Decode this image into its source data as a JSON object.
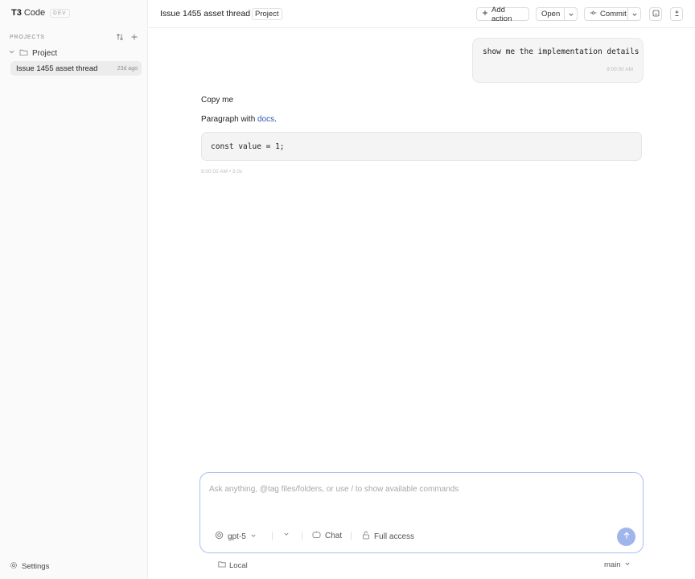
{
  "sidebar": {
    "brand_name": "T3",
    "brand_suffix": "Code",
    "env_badge": "DEV",
    "projects_label": "PROJECTS",
    "project": {
      "name": "Project",
      "expanded": true
    },
    "threads": [
      {
        "title": "Issue 1455 asset thread",
        "age": "23d ago",
        "active": true
      }
    ],
    "settings_label": "Settings"
  },
  "header": {
    "thread_title": "Issue 1455 asset thread",
    "project_chip": "Project",
    "add_action_label": "Add action",
    "open_label": "Open",
    "commit_label": "Commit"
  },
  "chat": {
    "user_message": {
      "text": "show me the implementation details",
      "time": "9:00:00 AM"
    },
    "assistant_message": {
      "line1": "Copy me",
      "paragraph_prefix": "Paragraph with ",
      "link_text": "docs",
      "paragraph_suffix": ".",
      "code": "const value = 1;",
      "meta": "9:00:02 AM • 3.0s"
    }
  },
  "composer": {
    "placeholder": "Ask anything, @tag files/folders, or use / to show available commands",
    "value": "",
    "model": "gpt-5",
    "mode": "Chat",
    "access": "Full access"
  },
  "footer": {
    "location": "Local",
    "branch": "main"
  },
  "colors": {
    "accent": "#9fb5ec",
    "composer_border": "#a9c0ef",
    "link": "#2a55b8",
    "sidebar_bg": "#fafafa",
    "active_thread_bg": "#ececec"
  },
  "icons": [
    "sort-icon",
    "plus-icon",
    "chevron-down-icon",
    "folder-icon",
    "settings-icon",
    "commit-icon",
    "panel-toggle-icon",
    "diff-icon",
    "openai-icon",
    "chat-icon",
    "lock-icon",
    "arrow-up-icon"
  ]
}
